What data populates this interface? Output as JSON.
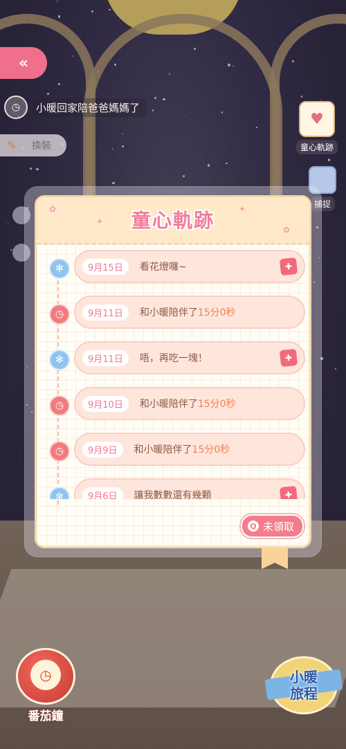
{
  "hud": {
    "notice_text": "小暖回家陪爸爸媽媽了",
    "dress_label": "換裝",
    "diary_label": "童心軌跡",
    "catch_label": "捕捉",
    "tomato_label": "番茄鐘",
    "journey_label_1": "小暖",
    "journey_label_2": "旅程"
  },
  "modal": {
    "title": "童心軌跡",
    "entries": [
      {
        "date": "9月15日",
        "text": "看花燈囉~",
        "type": "reward"
      },
      {
        "date": "9月11日",
        "text_prefix": "和小暖陪伴了",
        "duration": "15分0秒",
        "type": "companion"
      },
      {
        "date": "9月11日",
        "text": "唔，再吃一塊！",
        "type": "reward"
      },
      {
        "date": "9月10日",
        "text_prefix": "和小暖陪伴了",
        "duration": "15分0秒",
        "type": "companion"
      },
      {
        "date": "9月9日",
        "text_prefix": "和小暖陪伴了",
        "duration": "15分0秒",
        "type": "companion"
      },
      {
        "date": "9月6日",
        "text": "讓我數數還有幾顆",
        "type": "reward"
      }
    ],
    "unclaimed_label": "未領取"
  },
  "colors": {
    "accent_pink": "#f37d9a",
    "bubble": "#ffe6dd",
    "highlight_orange": "#f08050"
  }
}
